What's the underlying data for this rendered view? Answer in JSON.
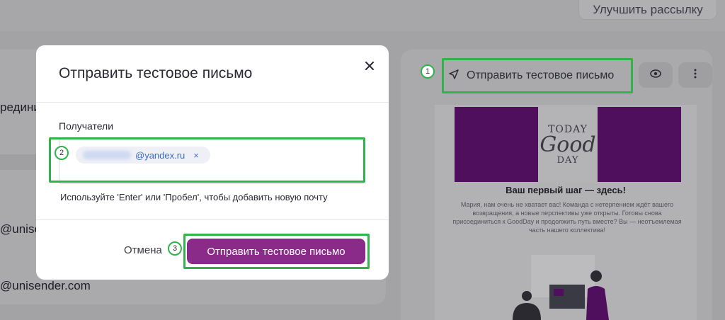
{
  "header": {
    "improve_label": "Улучшить рассылку"
  },
  "left_panel": {
    "row1_text": "редини",
    "row2_text": "@unise",
    "row3_text": "@unisender.com"
  },
  "right_panel": {
    "send_test_label": "Отправить тестовое письмо",
    "preview": {
      "banner_today": "TODAY",
      "banner_good": "Good",
      "banner_day": "DAY",
      "heading": "Ваш первый шаг — здесь!",
      "body": "Мария, нам очень не хватает вас! Команда с нетерпением ждёт вашего возвращения, а новые перспективы уже открыты. Готовы снова присоединиться к GoodDay и продолжить путь вместе? Вы — неотъемлемая часть нашего коллектива!"
    }
  },
  "modal": {
    "title": "Отправить тестовое письмо",
    "recipients_label": "Получатели",
    "recipient_email": "@yandex.ru",
    "recipient_remove": "×",
    "hint": "Используйте 'Enter' или 'Пробел', чтобы добавить новую почту",
    "cancel_label": "Отмена",
    "send_label": "Отправить тестовое письмо"
  },
  "annotations": [
    "1",
    "2",
    "3"
  ],
  "colors": {
    "accent": "#8a2a89",
    "annotation": "#2fb34a",
    "banner": "#4f0f5c",
    "chip_text": "#3a6ad0"
  }
}
